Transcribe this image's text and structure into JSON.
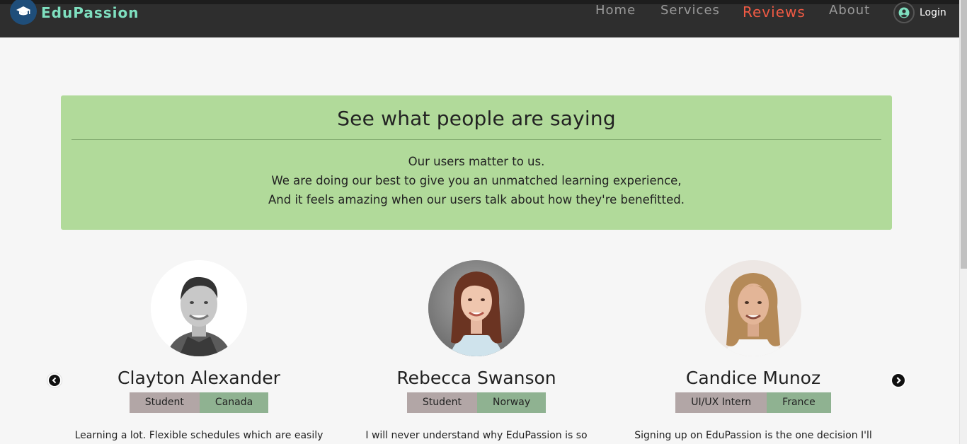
{
  "navbar": {
    "brand": "EduPassion",
    "links": [
      {
        "label": "Home",
        "active": false
      },
      {
        "label": "Services",
        "active": false
      },
      {
        "label": "Reviews",
        "active": true
      },
      {
        "label": "About",
        "active": false
      }
    ],
    "login_label": "Login",
    "accent_color": "#f05a44",
    "brand_color": "#7fe0c0"
  },
  "hero": {
    "title": "See what people are saying",
    "lines": [
      "Our users matter to us.",
      "We are doing our best to give you an unmatched learning experience,",
      "And it feels amazing when our users talk about how they're benefitted."
    ],
    "background": "#b1da9a"
  },
  "reviews": [
    {
      "name": "Clayton Alexander",
      "role": "Student",
      "country": "Canada",
      "text": "Learning a lot. Flexible schedules which are easily"
    },
    {
      "name": "Rebecca Swanson",
      "role": "Student",
      "country": "Norway",
      "text": "I will never understand why EduPassion is so"
    },
    {
      "name": "Candice Munoz",
      "role": "UI/UX Intern",
      "country": "France",
      "text": "Signing up on EduPassion is the one decision I'll"
    }
  ],
  "carousel": {
    "prev_icon": "chevron-left-icon",
    "next_icon": "chevron-right-icon"
  }
}
